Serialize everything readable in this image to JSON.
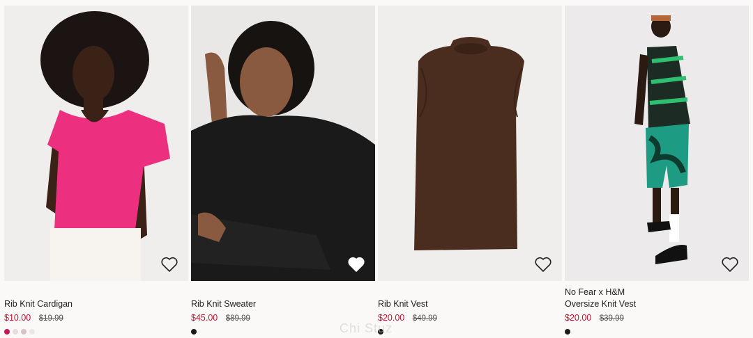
{
  "products": [
    {
      "brand": "",
      "name": "Rib Knit Cardigan",
      "sale_price": "$10.00",
      "original_price": "$19.99",
      "image_icon": "model-pink-cardigan",
      "swatches": [
        "#c2185b",
        "#e8dcdc",
        "#d9c2c2",
        "#ece7e7"
      ]
    },
    {
      "brand": "",
      "name": "Rib Knit Sweater",
      "sale_price": "$45.00",
      "original_price": "$89.99",
      "image_icon": "model-black-sweater",
      "swatches": [
        "#1a1a1a"
      ]
    },
    {
      "brand": "",
      "name": "Rib Knit Vest",
      "sale_price": "$20.00",
      "original_price": "$49.99",
      "image_icon": "brown-knit-vest",
      "swatches": [
        "#1a1a1a"
      ]
    },
    {
      "brand": "No Fear x H&M",
      "name": "Oversize Knit Vest",
      "sale_price": "$20.00",
      "original_price": "$39.99",
      "image_icon": "model-green-knit-vest",
      "swatches": [
        "#1a1a1a"
      ]
    }
  ],
  "watermark": "Chi Stuz",
  "colors": {
    "sale": "#c8102e",
    "text": "#222222"
  }
}
